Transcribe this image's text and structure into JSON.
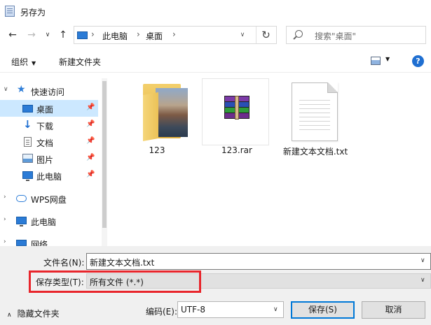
{
  "window": {
    "title": "另存为",
    "title_icon": "save-dialog-icon"
  },
  "nav": {
    "back_icon": "arrow-left-icon",
    "forward_icon": "arrow-right-icon",
    "recent_icon": "chevron-down-icon",
    "up_icon": "arrow-up-icon",
    "address": {
      "crumbs": [
        "此电脑",
        "桌面"
      ]
    },
    "search_placeholder": "搜索\"桌面\""
  },
  "toolbar": {
    "organize": "组织",
    "new_folder": "新建文件夹"
  },
  "sidebar": {
    "items": [
      {
        "label": "快速访问",
        "icon": "star-icon"
      },
      {
        "label": "桌面",
        "icon": "desktop-icon",
        "selected": true
      },
      {
        "label": "下载",
        "icon": "download-icon"
      },
      {
        "label": "文档",
        "icon": "document-icon"
      },
      {
        "label": "图片",
        "icon": "pictures-icon"
      },
      {
        "label": "此电脑",
        "icon": "computer-icon"
      },
      {
        "label": "WPS网盘",
        "icon": "cloud-icon"
      },
      {
        "label": "此电脑",
        "icon": "computer-icon"
      },
      {
        "label": "网络",
        "icon": "network-icon"
      }
    ]
  },
  "files": [
    {
      "name": "123",
      "type": "folder"
    },
    {
      "name": "123.rar",
      "type": "rar"
    },
    {
      "name": "新建文本文档.txt",
      "type": "txt"
    }
  ],
  "form": {
    "filename_label": "文件名(N):",
    "filename_value": "新建文本文档.txt",
    "type_label": "保存类型(T):",
    "type_value": "所有文件  (*.*)",
    "hide_folders": "隐藏文件夹",
    "encoding_label": "编码(E):",
    "encoding_value": "UTF-8",
    "save_label": "保存(S)",
    "cancel_label": "取消"
  },
  "colors": {
    "highlight": "#e8262c",
    "selection": "#cce8ff",
    "accent": "#0078d7"
  }
}
